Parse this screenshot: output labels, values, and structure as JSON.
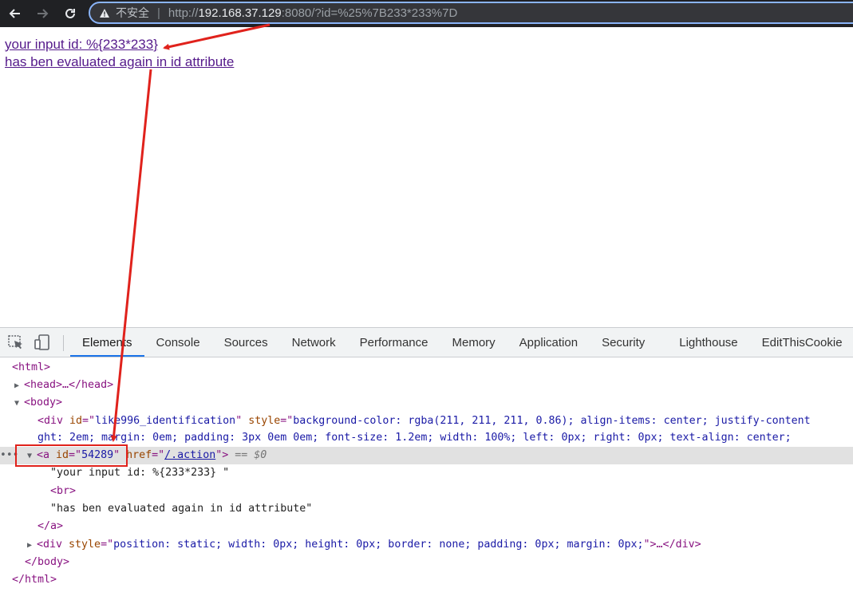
{
  "browser": {
    "warning_label": "不安全",
    "url_prefix": "http://",
    "url_host": "192.168.37.129",
    "url_rest": ":8080/?id=%25%7B233*233%7D"
  },
  "page": {
    "link_line1": "your input id: %{233*233}",
    "link_line2": "has ben evaluated again in id attribute"
  },
  "devtools": {
    "tabs": [
      "Elements",
      "Console",
      "Sources",
      "Network",
      "Performance",
      "Memory",
      "Application",
      "Security",
      "Lighthouse",
      "EditThisCookie"
    ],
    "active_tab": "Elements",
    "lines": {
      "html_open": "<html>",
      "head": "<head>…</head>",
      "body_open": "<body>",
      "div_attr_name": "id",
      "div_id": "like996_identification",
      "div_style_attr": "style",
      "div_style_value": "background-color: rgba(211, 211, 211, 0.86); align-items: center; justify-content",
      "div_cont": "ght: 2em; margin: 0em; padding: 3px 0em 0em; font-size: 1.2em; width: 100%; left: 0px; right: 0px; text-align: center;",
      "a_id": "54289",
      "a_href": "/.action",
      "selected_marker": "== $0",
      "text1": "\"your input id: %{233*233} \"",
      "br": "<br>",
      "text2": "\"has ben evaluated again in id attribute\"",
      "a_close": "</a>",
      "div2_style": "position: static; width: 0px; height: 0px; border: none; padding: 0px; margin: 0px;",
      "div2_tail": ">…</div>",
      "body_close": "</body>",
      "html_close": "</html>"
    }
  },
  "colors": {
    "annotation": "#e0221c",
    "active_tab_underline": "#1a73e8",
    "visited_link": "#551a8b"
  }
}
